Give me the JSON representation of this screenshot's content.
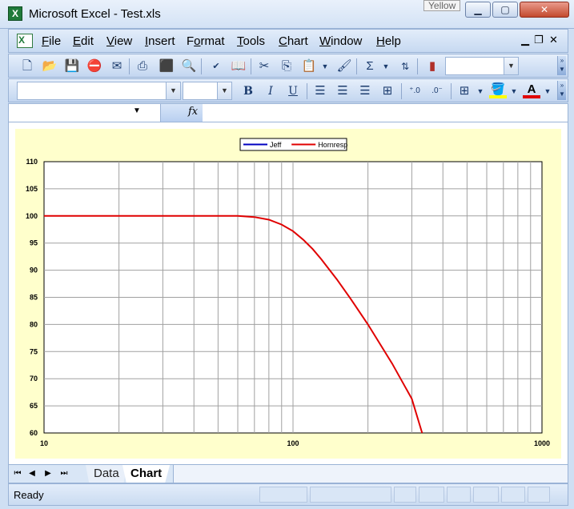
{
  "window": {
    "title": "Microsoft Excel - Test.xls",
    "tooltip": "Yellow",
    "min_label": "▁",
    "max_label": "▢",
    "close_label": "✕"
  },
  "menu": {
    "items": [
      {
        "pre": "",
        "u": "F",
        "post": "ile"
      },
      {
        "pre": "",
        "u": "E",
        "post": "dit"
      },
      {
        "pre": "",
        "u": "V",
        "post": "iew"
      },
      {
        "pre": "",
        "u": "I",
        "post": "nsert"
      },
      {
        "pre": "F",
        "u": "o",
        "post": "rmat"
      },
      {
        "pre": "",
        "u": "T",
        "post": "ools"
      },
      {
        "pre": "",
        "u": "C",
        "post": "hart"
      },
      {
        "pre": "",
        "u": "W",
        "post": "indow"
      },
      {
        "pre": "",
        "u": "H",
        "post": "elp"
      }
    ],
    "mdi_min": "▁",
    "mdi_restore": "❐",
    "mdi_close": "✕"
  },
  "toolbar_format": {
    "bold": "B",
    "italic": "I",
    "underline": "U"
  },
  "formula_bar": {
    "fx": "fx"
  },
  "chart_data": {
    "type": "line",
    "x_scale": "log",
    "xlim": [
      10,
      1000
    ],
    "ylim": [
      60,
      110
    ],
    "x_ticks": [
      10,
      100,
      1000
    ],
    "y_ticks": [
      60,
      65,
      70,
      75,
      80,
      85,
      90,
      95,
      100,
      105,
      110
    ],
    "grid": true,
    "legend_position": "top",
    "series": [
      {
        "name": "Jeff",
        "color": "#0000c0",
        "x": [],
        "y": []
      },
      {
        "name": "Hornresp",
        "color": "#e00000",
        "x": [
          10,
          20,
          40,
          60,
          70,
          80,
          90,
          100,
          110,
          120,
          130,
          150,
          170,
          200,
          250,
          300,
          330
        ],
        "y": [
          100,
          100,
          100,
          100,
          99.8,
          99.3,
          98.4,
          97.2,
          95.6,
          93.9,
          92.0,
          88.3,
          84.8,
          80.0,
          72.8,
          66.3,
          60
        ]
      }
    ]
  },
  "tabs": {
    "data": "Data",
    "chart": "Chart"
  },
  "status": {
    "text": "Ready"
  }
}
